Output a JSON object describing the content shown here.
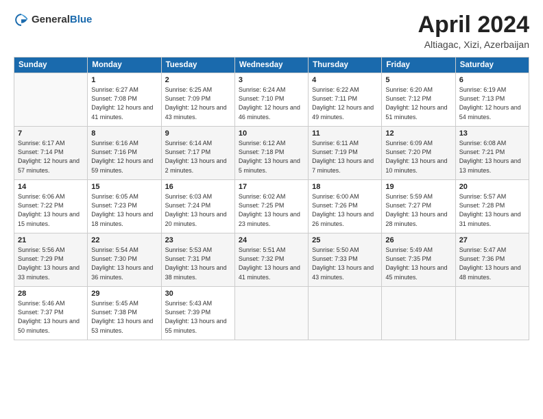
{
  "logo": {
    "general": "General",
    "blue": "Blue"
  },
  "title": "April 2024",
  "subtitle": "Altiagac, Xizi, Azerbaijan",
  "days_of_week": [
    "Sunday",
    "Monday",
    "Tuesday",
    "Wednesday",
    "Thursday",
    "Friday",
    "Saturday"
  ],
  "weeks": [
    [
      {
        "day": "",
        "sunrise": "",
        "sunset": "",
        "daylight": ""
      },
      {
        "day": "1",
        "sunrise": "Sunrise: 6:27 AM",
        "sunset": "Sunset: 7:08 PM",
        "daylight": "Daylight: 12 hours and 41 minutes."
      },
      {
        "day": "2",
        "sunrise": "Sunrise: 6:25 AM",
        "sunset": "Sunset: 7:09 PM",
        "daylight": "Daylight: 12 hours and 43 minutes."
      },
      {
        "day": "3",
        "sunrise": "Sunrise: 6:24 AM",
        "sunset": "Sunset: 7:10 PM",
        "daylight": "Daylight: 12 hours and 46 minutes."
      },
      {
        "day": "4",
        "sunrise": "Sunrise: 6:22 AM",
        "sunset": "Sunset: 7:11 PM",
        "daylight": "Daylight: 12 hours and 49 minutes."
      },
      {
        "day": "5",
        "sunrise": "Sunrise: 6:20 AM",
        "sunset": "Sunset: 7:12 PM",
        "daylight": "Daylight: 12 hours and 51 minutes."
      },
      {
        "day": "6",
        "sunrise": "Sunrise: 6:19 AM",
        "sunset": "Sunset: 7:13 PM",
        "daylight": "Daylight: 12 hours and 54 minutes."
      }
    ],
    [
      {
        "day": "7",
        "sunrise": "Sunrise: 6:17 AM",
        "sunset": "Sunset: 7:14 PM",
        "daylight": "Daylight: 12 hours and 57 minutes."
      },
      {
        "day": "8",
        "sunrise": "Sunrise: 6:16 AM",
        "sunset": "Sunset: 7:16 PM",
        "daylight": "Daylight: 12 hours and 59 minutes."
      },
      {
        "day": "9",
        "sunrise": "Sunrise: 6:14 AM",
        "sunset": "Sunset: 7:17 PM",
        "daylight": "Daylight: 13 hours and 2 minutes."
      },
      {
        "day": "10",
        "sunrise": "Sunrise: 6:12 AM",
        "sunset": "Sunset: 7:18 PM",
        "daylight": "Daylight: 13 hours and 5 minutes."
      },
      {
        "day": "11",
        "sunrise": "Sunrise: 6:11 AM",
        "sunset": "Sunset: 7:19 PM",
        "daylight": "Daylight: 13 hours and 7 minutes."
      },
      {
        "day": "12",
        "sunrise": "Sunrise: 6:09 AM",
        "sunset": "Sunset: 7:20 PM",
        "daylight": "Daylight: 13 hours and 10 minutes."
      },
      {
        "day": "13",
        "sunrise": "Sunrise: 6:08 AM",
        "sunset": "Sunset: 7:21 PM",
        "daylight": "Daylight: 13 hours and 13 minutes."
      }
    ],
    [
      {
        "day": "14",
        "sunrise": "Sunrise: 6:06 AM",
        "sunset": "Sunset: 7:22 PM",
        "daylight": "Daylight: 13 hours and 15 minutes."
      },
      {
        "day": "15",
        "sunrise": "Sunrise: 6:05 AM",
        "sunset": "Sunset: 7:23 PM",
        "daylight": "Daylight: 13 hours and 18 minutes."
      },
      {
        "day": "16",
        "sunrise": "Sunrise: 6:03 AM",
        "sunset": "Sunset: 7:24 PM",
        "daylight": "Daylight: 13 hours and 20 minutes."
      },
      {
        "day": "17",
        "sunrise": "Sunrise: 6:02 AM",
        "sunset": "Sunset: 7:25 PM",
        "daylight": "Daylight: 13 hours and 23 minutes."
      },
      {
        "day": "18",
        "sunrise": "Sunrise: 6:00 AM",
        "sunset": "Sunset: 7:26 PM",
        "daylight": "Daylight: 13 hours and 26 minutes."
      },
      {
        "day": "19",
        "sunrise": "Sunrise: 5:59 AM",
        "sunset": "Sunset: 7:27 PM",
        "daylight": "Daylight: 13 hours and 28 minutes."
      },
      {
        "day": "20",
        "sunrise": "Sunrise: 5:57 AM",
        "sunset": "Sunset: 7:28 PM",
        "daylight": "Daylight: 13 hours and 31 minutes."
      }
    ],
    [
      {
        "day": "21",
        "sunrise": "Sunrise: 5:56 AM",
        "sunset": "Sunset: 7:29 PM",
        "daylight": "Daylight: 13 hours and 33 minutes."
      },
      {
        "day": "22",
        "sunrise": "Sunrise: 5:54 AM",
        "sunset": "Sunset: 7:30 PM",
        "daylight": "Daylight: 13 hours and 36 minutes."
      },
      {
        "day": "23",
        "sunrise": "Sunrise: 5:53 AM",
        "sunset": "Sunset: 7:31 PM",
        "daylight": "Daylight: 13 hours and 38 minutes."
      },
      {
        "day": "24",
        "sunrise": "Sunrise: 5:51 AM",
        "sunset": "Sunset: 7:32 PM",
        "daylight": "Daylight: 13 hours and 41 minutes."
      },
      {
        "day": "25",
        "sunrise": "Sunrise: 5:50 AM",
        "sunset": "Sunset: 7:33 PM",
        "daylight": "Daylight: 13 hours and 43 minutes."
      },
      {
        "day": "26",
        "sunrise": "Sunrise: 5:49 AM",
        "sunset": "Sunset: 7:35 PM",
        "daylight": "Daylight: 13 hours and 45 minutes."
      },
      {
        "day": "27",
        "sunrise": "Sunrise: 5:47 AM",
        "sunset": "Sunset: 7:36 PM",
        "daylight": "Daylight: 13 hours and 48 minutes."
      }
    ],
    [
      {
        "day": "28",
        "sunrise": "Sunrise: 5:46 AM",
        "sunset": "Sunset: 7:37 PM",
        "daylight": "Daylight: 13 hours and 50 minutes."
      },
      {
        "day": "29",
        "sunrise": "Sunrise: 5:45 AM",
        "sunset": "Sunset: 7:38 PM",
        "daylight": "Daylight: 13 hours and 53 minutes."
      },
      {
        "day": "30",
        "sunrise": "Sunrise: 5:43 AM",
        "sunset": "Sunset: 7:39 PM",
        "daylight": "Daylight: 13 hours and 55 minutes."
      },
      {
        "day": "",
        "sunrise": "",
        "sunset": "",
        "daylight": ""
      },
      {
        "day": "",
        "sunrise": "",
        "sunset": "",
        "daylight": ""
      },
      {
        "day": "",
        "sunrise": "",
        "sunset": "",
        "daylight": ""
      },
      {
        "day": "",
        "sunrise": "",
        "sunset": "",
        "daylight": ""
      }
    ]
  ]
}
